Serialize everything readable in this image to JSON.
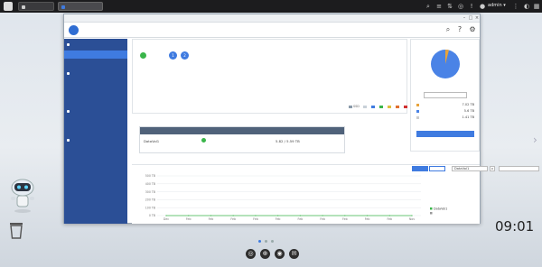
{
  "taskbar": {
    "tab1_label": "",
    "tab2_label": "",
    "user_label": "admin ▾"
  },
  "window": {
    "title": "",
    "app_name": ""
  },
  "sidebar": {
    "group1": "",
    "group1_items": [
      "",
      ""
    ],
    "group2": "",
    "group2_items": [
      "",
      "",
      ""
    ],
    "group3": "",
    "group3_items": [
      "",
      ""
    ],
    "group4": "",
    "group4_items": [
      "",
      "",
      ""
    ]
  },
  "pool": {
    "header": "",
    "status": "",
    "disks": [
      "1",
      "2"
    ],
    "legend": [
      "SSD",
      "",
      "",
      "",
      "",
      "",
      ""
    ]
  },
  "right": {
    "title": "",
    "pool_select": "",
    "stats": [
      {
        "label": "",
        "value": "7.02 TB"
      },
      {
        "label": "",
        "value": "5.6 TB"
      },
      {
        "label": "",
        "value": "1.41 TB"
      }
    ],
    "used_bar": "",
    "pie_used_pct": 96
  },
  "volumes": {
    "title": "",
    "columns": [
      "",
      "",
      "",
      "",
      ""
    ],
    "row": {
      "name": "DataVol1",
      "status": "",
      "type": "",
      "capacity": "5.82 / 5.59 TB",
      "pool": ""
    }
  },
  "chart": {
    "title": "",
    "seg1": "",
    "seg2": "",
    "volume_select": "DataVol1",
    "range_select": "",
    "series": [
      "DataVol1",
      ""
    ]
  },
  "chart_data": {
    "type": "line",
    "title": "",
    "xlabel": "",
    "ylabel": "",
    "categories": [
      "Dec",
      "Feb",
      "Feb",
      "Feb",
      "Feb",
      "Feb",
      "Feb",
      "Feb",
      "Feb",
      "Feb",
      "Feb",
      "Nov"
    ],
    "ylim": [
      0,
      500
    ],
    "yticks": [
      "500 TB",
      "400 TB",
      "300 TB",
      "200 TB",
      "100 TB",
      "0 TB"
    ],
    "series": [
      {
        "name": "DataVol1",
        "values": [
          0,
          0,
          0,
          0,
          0,
          0,
          0,
          0,
          0,
          0,
          0,
          0
        ]
      }
    ]
  },
  "desktop": {
    "time": "09:01",
    "date": ""
  },
  "colors": {
    "accent": "#3f7be0",
    "sidebar": "#2b4f96",
    "ok": "#3ab54a"
  }
}
